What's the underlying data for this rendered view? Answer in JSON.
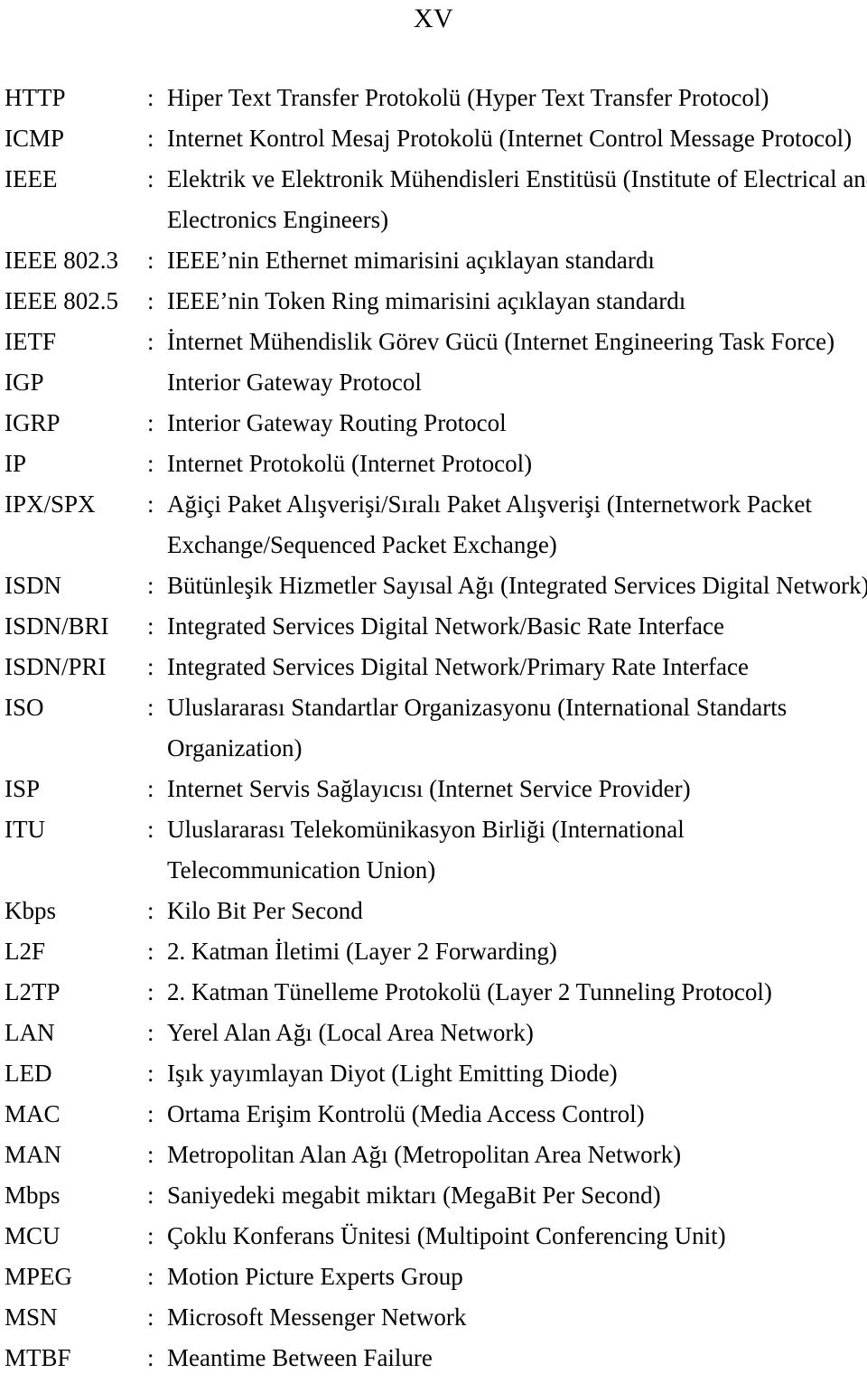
{
  "header": {
    "page_number": "XV"
  },
  "abbreviations": {
    "separator": ":",
    "entries": [
      {
        "term": "HTTP",
        "separator": ":",
        "lines": [
          "Hiper Text Transfer Protokolü (Hyper Text Transfer Protocol)"
        ]
      },
      {
        "term": "ICMP",
        "separator": ":",
        "lines": [
          "Internet Kontrol Mesaj Protokolü (Internet Control Message Protocol)"
        ]
      },
      {
        "term": "IEEE",
        "separator": ":",
        "lines": [
          "Elektrik ve Elektronik Mühendisleri Enstitüsü (Institute of Electrical and",
          "Electronics Engineers)"
        ]
      },
      {
        "term": "IEEE 802.3",
        "separator": ":",
        "lines": [
          "IEEE’nin Ethernet mimarisini açıklayan standardı"
        ]
      },
      {
        "term": "IEEE 802.5",
        "separator": ":",
        "lines": [
          "IEEE’nin Token Ring mimarisini açıklayan standardı"
        ]
      },
      {
        "term": "IETF",
        "separator": ":",
        "lines": [
          "İnternet Mühendislik Görev Gücü (Internet Engineering Task Force)"
        ]
      },
      {
        "term": "IGP",
        "separator": "",
        "lines": [
          "Interior Gateway Protocol"
        ]
      },
      {
        "term": "IGRP",
        "separator": ":",
        "lines": [
          "Interior Gateway Routing Protocol"
        ]
      },
      {
        "term": "IP",
        "separator": ":",
        "lines": [
          "Internet Protokolü (Internet Protocol)"
        ]
      },
      {
        "term": "IPX/SPX",
        "separator": ":",
        "lines": [
          "Ağiçi Paket Alışverişi/Sıralı Paket Alışverişi (Internetwork Packet",
          "Exchange/Sequenced Packet Exchange)"
        ]
      },
      {
        "term": "ISDN",
        "separator": ":",
        "lines": [
          "Bütünleşik Hizmetler Sayısal Ağı (Integrated Services Digital Network)"
        ]
      },
      {
        "term": "ISDN/BRI",
        "separator": ":",
        "lines": [
          "Integrated Services Digital Network/Basic Rate Interface"
        ]
      },
      {
        "term": "ISDN/PRI",
        "separator": ":",
        "lines": [
          "Integrated Services Digital Network/Primary Rate Interface"
        ]
      },
      {
        "term": "ISO",
        "separator": ":",
        "lines": [
          "Uluslararası Standartlar Organizasyonu (International Standarts",
          "Organization)"
        ]
      },
      {
        "term": "ISP",
        "separator": ":",
        "lines": [
          "Internet Servis Sağlayıcısı (Internet Service Provider)"
        ]
      },
      {
        "term": "ITU",
        "separator": ":",
        "lines": [
          "Uluslararası Telekomünikasyon Birliği (International",
          "Telecommunication Union)"
        ]
      },
      {
        "term": "Kbps",
        "separator": ":",
        "lines": [
          "Kilo Bit Per Second"
        ]
      },
      {
        "term": "L2F",
        "separator": ":",
        "lines": [
          "2. Katman İletimi (Layer 2 Forwarding)"
        ]
      },
      {
        "term": "L2TP",
        "separator": ":",
        "lines": [
          "2. Katman Tünelleme Protokolü (Layer 2 Tunneling Protocol)"
        ]
      },
      {
        "term": "LAN",
        "separator": ":",
        "lines": [
          "Yerel Alan Ağı (Local Area Network)"
        ]
      },
      {
        "term": "LED",
        "separator": ":",
        "lines": [
          "Işık yayımlayan Diyot (Light Emitting Diode)"
        ]
      },
      {
        "term": "MAC",
        "separator": ":",
        "lines": [
          "Ortama Erişim Kontrolü (Media Access Control)"
        ]
      },
      {
        "term": "MAN",
        "separator": ":",
        "lines": [
          "Metropolitan Alan Ağı (Metropolitan Area Network)"
        ]
      },
      {
        "term": "Mbps",
        "separator": ":",
        "lines": [
          "Saniyedeki megabit miktarı (MegaBit Per Second)"
        ]
      },
      {
        "term": "MCU",
        "separator": ":",
        "lines": [
          "Çoklu Konferans Ünitesi (Multipoint Conferencing Unit)"
        ]
      },
      {
        "term": "MPEG",
        "separator": ":",
        "lines": [
          "Motion Picture Experts Group"
        ]
      },
      {
        "term": "MSN",
        "separator": ":",
        "lines": [
          "Microsoft Messenger Network"
        ]
      },
      {
        "term": "MTBF",
        "separator": ":",
        "lines": [
          "Meantime Between Failure"
        ]
      }
    ]
  }
}
